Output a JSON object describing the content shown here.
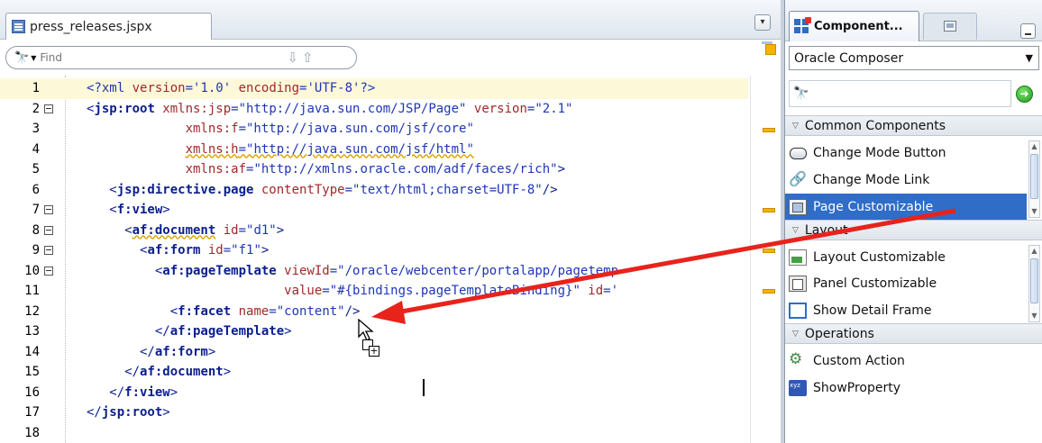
{
  "editor": {
    "tab_label": "press_releases.jspx",
    "find_placeholder": "Find",
    "lines": [
      {
        "n": "1",
        "html": "<span class='tok-pi'>&lt;?</span><span class='tok-pi'>xml</span><span class='tok-attr'> version</span><span class='tok-val'>='1.0'</span><span class='tok-attr'> encoding</span><span class='tok-val'>='UTF-8'</span><span class='tok-pi'>?&gt;</span>"
      },
      {
        "n": "2",
        "html": "<span class='tok-plain'>&lt;</span><span class='tok-tag'>jsp:root</span><span class='tok-attr'> xmlns:jsp</span><span class='tok-val'>=\"http://java.sun.com/JSP/Page\"</span><span class='tok-attr'> version</span><span class='tok-val'>=\"2.1\"</span>"
      },
      {
        "n": "3",
        "html": "<span class='tok-attr'>             xmlns:f</span><span class='tok-val'>=\"http://java.sun.com/jsf/core\"</span>"
      },
      {
        "n": "4",
        "html": "<span class='tok-attr'>             <span class='squiggle'>xmlns:h</span></span><span class='tok-val'><span class='squiggle'>=\"http://java.sun.com/jsf/html\"</span></span>"
      },
      {
        "n": "5",
        "html": "<span class='tok-attr'>             xmlns:af</span><span class='tok-val'>=\"http://xmlns.oracle.com/adf/faces/rich\"</span><span class='tok-plain'>&gt;</span>"
      },
      {
        "n": "6",
        "html": "<span class='tok-plain'>   &lt;</span><span class='tok-tag'>jsp:directive.page</span><span class='tok-attr'> contentType</span><span class='tok-val'>=\"text/html;charset=UTF-8\"</span><span class='tok-plain'>/&gt;</span>"
      },
      {
        "n": "7",
        "html": "<span class='tok-plain'>   &lt;</span><span class='tok-tag'>f:view</span><span class='tok-plain'>&gt;</span>"
      },
      {
        "n": "8",
        "html": "<span class='tok-plain'>     &lt;</span><span class='tok-tag'><span class='squiggle'>af:document</span></span><span class='tok-attr'> id</span><span class='tok-val'>=\"d1\"</span><span class='tok-plain'>&gt;</span>"
      },
      {
        "n": "9",
        "html": "<span class='tok-plain'>       &lt;</span><span class='tok-tag'>af:form</span><span class='tok-attr'> id</span><span class='tok-val'>=\"f1\"</span><span class='tok-plain'>&gt;</span>"
      },
      {
        "n": "10",
        "html": "<span class='tok-plain'>         &lt;</span><span class='tok-tag'>af:pageTemplate</span><span class='tok-attr'> viewId</span><span class='tok-val'>=\"/oracle/webcenter/portalapp/pagetemp</span>"
      },
      {
        "n": "11",
        "html": "<span class='tok-attr'>                          value</span><span class='tok-val'>=\"#{bindings.pageTemplateBinding}\"</span><span class='tok-attr'> id</span><span class='tok-val'>='</span>"
      },
      {
        "n": "12",
        "html": "<span class='tok-plain'>           &lt;</span><span class='tok-tag'>f:facet</span><span class='tok-attr'> name</span><span class='tok-val'>=\"content\"</span><span class='tok-plain'>/&gt;</span>"
      },
      {
        "n": "13",
        "html": "<span class='tok-plain'>         &lt;/</span><span class='tok-tag'>af:pageTemplate</span><span class='tok-plain'>&gt;</span>"
      },
      {
        "n": "14",
        "html": "<span class='tok-plain'>       &lt;/</span><span class='tok-tag'>af:form</span><span class='tok-plain'>&gt;</span>"
      },
      {
        "n": "15",
        "html": "<span class='tok-plain'>     &lt;/</span><span class='tok-tag'>af:document</span><span class='tok-plain'>&gt;</span>"
      },
      {
        "n": "16",
        "html": "<span class='tok-plain'>   &lt;/</span><span class='tok-tag'>f:view</span><span class='tok-plain'>&gt;</span>"
      },
      {
        "n": "17",
        "html": "<span class='tok-plain'>&lt;/</span><span class='tok-tag'>jsp:root</span><span class='tok-plain'>&gt;</span>"
      },
      {
        "n": "18",
        "html": ""
      }
    ]
  },
  "palette": {
    "tab_label": "Component...",
    "library": "Oracle Composer",
    "sections": [
      {
        "label": "Common Components",
        "items": [
          "Change Mode Button",
          "Change Mode Link",
          "Page Customizable"
        ]
      },
      {
        "label": "Layout",
        "items": [
          "Layout Customizable",
          "Panel Customizable",
          "Show Detail Frame"
        ]
      },
      {
        "label": "Operations",
        "items": [
          "Custom Action",
          "ShowProperty"
        ]
      }
    ],
    "selected_item": "Page Customizable"
  },
  "colors": {
    "drag_arrow": "#e8231c",
    "selection": "#2f6dc7",
    "warning_mark": "#f5b400"
  }
}
